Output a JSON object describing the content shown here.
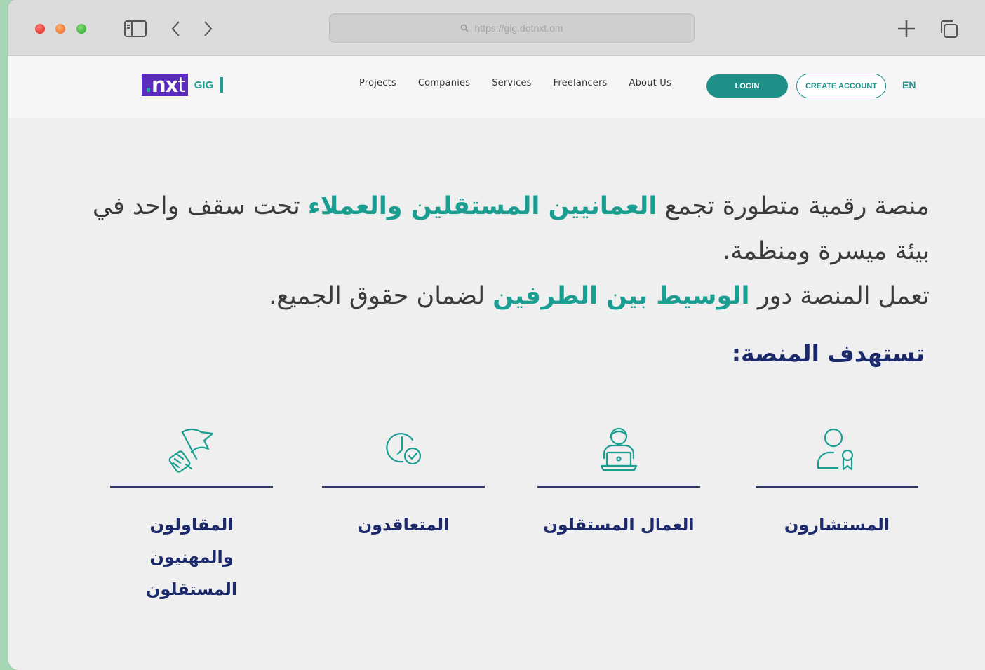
{
  "browser": {
    "url": "https://gig.dotnxt.om"
  },
  "header": {
    "logo": {
      "prefix_dot": ".",
      "brand_bold": "nx",
      "brand_light": "t",
      "suffix": "GIG"
    },
    "nav": [
      "Projects",
      "Companies",
      "Services",
      "Freelancers",
      "About Us"
    ],
    "login_label": "LOGIN",
    "create_account_label": "CREATE ACCOUNT",
    "language": "EN"
  },
  "hero": {
    "line1_a": "منصة رقمية متطورة تجمع ",
    "line1_highlight": "العمانيين المستقلين والعملاء",
    "line1_b": " تحت سقف واحد في بيئة ميسرة ومنظمة.",
    "line2_a": "تعمل المنصة دور ",
    "line2_highlight": "الوسيط بين الطرفين",
    "line2_b": " لضمان حقوق الجميع."
  },
  "targets_heading": "تستهدف المنصة:",
  "targets": [
    {
      "icon": "consultant-icon",
      "label": "المستشارون"
    },
    {
      "icon": "freelancer-laptop-icon",
      "label": "العمال المستقلون"
    },
    {
      "icon": "clock-check-icon",
      "label": "المتعاقدون"
    },
    {
      "icon": "flag-fist-icon",
      "label": "المقاولون والمهنيون المستقلون"
    }
  ],
  "colors": {
    "accent": "#1a9e92",
    "navy": "#1c2a6b",
    "logo_purple": "#5b2bbd",
    "page_bg": "#efefef",
    "outer_bg": "#a6d6b4"
  }
}
